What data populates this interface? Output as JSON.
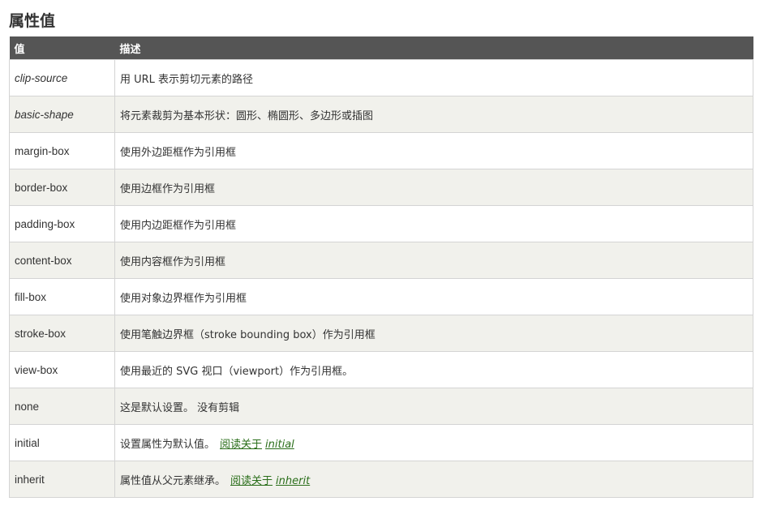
{
  "section": {
    "title": "属性值"
  },
  "table": {
    "headers": {
      "value": "值",
      "description": "描述"
    },
    "rows": [
      {
        "value": "clip-source",
        "italic": true,
        "description": "用 URL 表示剪切元素的路径"
      },
      {
        "value": "basic-shape",
        "italic": true,
        "description": "将元素裁剪为基本形状：圆形、椭圆形、多边形或插图"
      },
      {
        "value": "margin-box",
        "italic": false,
        "description": "使用外边距框作为引用框"
      },
      {
        "value": "border-box",
        "italic": false,
        "description": "使用边框作为引用框"
      },
      {
        "value": "padding-box",
        "italic": false,
        "description": "使用内边距框作为引用框"
      },
      {
        "value": "content-box",
        "italic": false,
        "description": "使用内容框作为引用框"
      },
      {
        "value": "fill-box",
        "italic": false,
        "description": "使用对象边界框作为引用框"
      },
      {
        "value": "stroke-box",
        "italic": false,
        "description": "使用笔触边界框（stroke bounding box）作为引用框"
      },
      {
        "value": "view-box",
        "italic": false,
        "description": "使用最近的 SVG 视口（viewport）作为引用框。"
      },
      {
        "value": "none",
        "italic": false,
        "description": "这是默认设置。 没有剪辑"
      },
      {
        "value": "initial",
        "italic": false,
        "description": "设置属性为默认值。",
        "link_text": "阅读关于",
        "link_keyword": "initial"
      },
      {
        "value": "inherit",
        "italic": false,
        "description": "属性值从父元素继承。",
        "link_text": "阅读关于",
        "link_keyword": "inherit"
      }
    ]
  },
  "colors": {
    "header_bg": "#555555",
    "header_text": "#ffffff",
    "row_alt_bg": "#f1f1ec",
    "border": "#d4d4d4",
    "link": "#2a6e1a"
  }
}
